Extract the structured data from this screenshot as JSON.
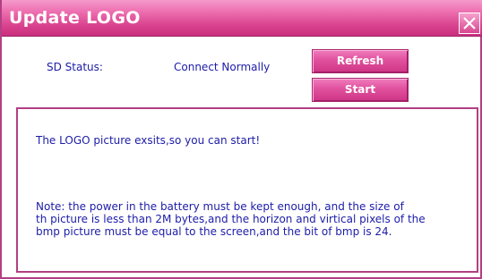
{
  "window": {
    "title": "Update LOGO",
    "close_icon": "close-x-icon"
  },
  "sd": {
    "label": "SD Status:",
    "value": "Connect Normally"
  },
  "buttons": {
    "refresh_label": "Refresh",
    "start_label": "Start"
  },
  "message": {
    "status": "The LOGO picture exsits,so you can start!",
    "note_lines": [
      "Note: the power in the battery must be kept enough, and the size of",
      "th picture is less than 2M bytes,and the horizon and virtical pixels of the",
      "bmp picture must be equal to the screen,and the bit of bmp is 24."
    ]
  },
  "colors": {
    "accent": "#d9448f",
    "border": "#b23f84",
    "text": "#1c1ca8"
  }
}
